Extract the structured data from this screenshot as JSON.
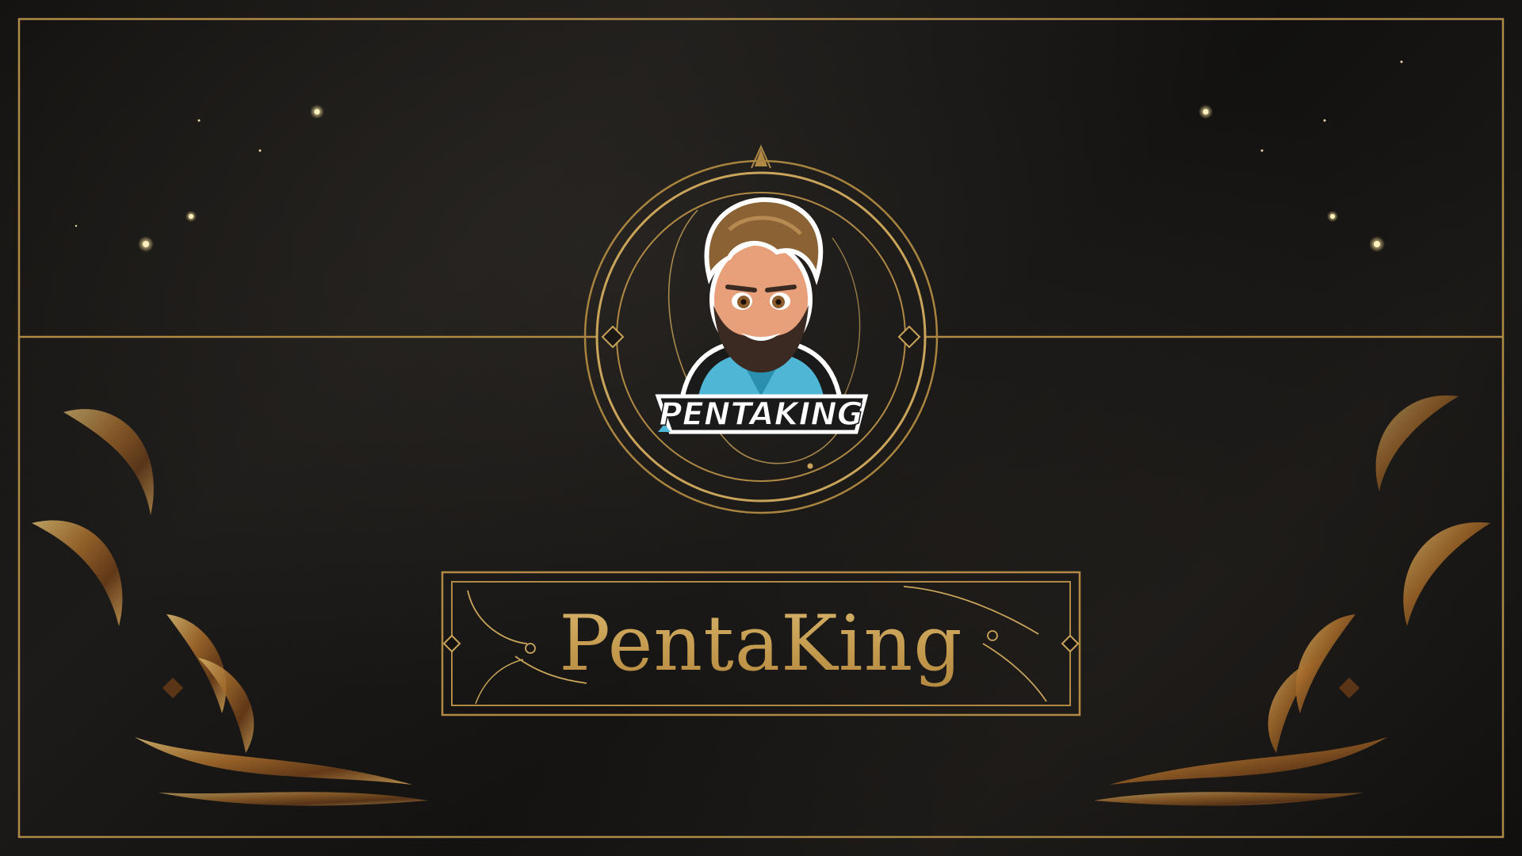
{
  "banner": {
    "title": "PentaKing"
  },
  "logo": {
    "wordmark": "PENTAKING",
    "icon": "bearded-avatar-mascot-icon"
  },
  "colors": {
    "gold": "#c9a45a",
    "gold_dark": "#8a6a2e",
    "background": "#141210",
    "hoodie_blue": "#4fb6d6"
  }
}
